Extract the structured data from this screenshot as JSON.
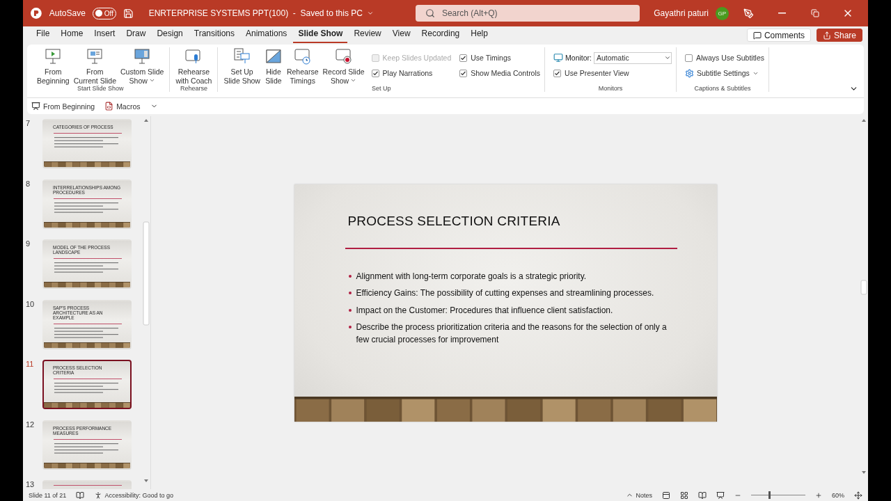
{
  "title_bar": {
    "autosave_label": "AutoSave",
    "autosave": {
      "on": false,
      "label": "Off"
    },
    "document": "ENRTERPRISE SYSTEMS PPT(100)  -  Saved to this PC",
    "search_placeholder": "Search (Alt+Q)",
    "user": "Gayathri paturi",
    "avatar": "GP"
  },
  "menu_tabs": [
    {
      "label": "File",
      "selected": false
    },
    {
      "label": "Home",
      "selected": false
    },
    {
      "label": "Insert",
      "selected": false
    },
    {
      "label": "Draw",
      "selected": false
    },
    {
      "label": "Design",
      "selected": false
    },
    {
      "label": "Transitions",
      "selected": false
    },
    {
      "label": "Animations",
      "selected": false
    },
    {
      "label": "Slide Show",
      "selected": true
    },
    {
      "label": "Review",
      "selected": false
    },
    {
      "label": "View",
      "selected": false
    },
    {
      "label": "Recording",
      "selected": false
    },
    {
      "label": "Help",
      "selected": false
    }
  ],
  "actions": {
    "comments": "Comments",
    "share": "Share"
  },
  "ribbon_groups": [
    {
      "title": "Start Slide Show",
      "items": [
        {
          "kind": "big",
          "lines": [
            "From",
            "Beginning"
          ],
          "dropdown": false
        },
        {
          "kind": "big",
          "lines": [
            "From",
            "Current Slide"
          ],
          "dropdown": false
        },
        {
          "kind": "big",
          "lines": [
            "Custom Slide",
            "Show"
          ],
          "dropdown": true
        }
      ]
    },
    {
      "title": "Rehearse",
      "items": [
        {
          "kind": "big",
          "lines": [
            "Rehearse",
            "with Coach"
          ],
          "dropdown": false
        }
      ]
    },
    {
      "title": "Set Up",
      "items": [
        {
          "kind": "big",
          "lines": [
            "Set Up",
            "Slide Show"
          ],
          "dropdown": false
        },
        {
          "kind": "big",
          "lines": [
            "Hide",
            "Slide"
          ],
          "dropdown": false
        },
        {
          "kind": "big",
          "lines": [
            "Rehearse",
            "Timings"
          ],
          "dropdown": false
        },
        {
          "kind": "big",
          "lines": [
            "Record Slide",
            "Show"
          ],
          "dropdown": true
        },
        {
          "kind": "checkbox",
          "label": "Keep Slides Updated",
          "checked": false,
          "disabled": true
        },
        {
          "kind": "checkbox",
          "label": "Play Narrations",
          "checked": true,
          "disabled": false
        },
        {
          "kind": "checkbox",
          "label": "Use Timings",
          "checked": true,
          "disabled": false
        },
        {
          "kind": "checkbox",
          "label": "Show Media Controls",
          "checked": true,
          "disabled": false
        }
      ]
    },
    {
      "title": "Monitors",
      "items": [
        {
          "kind": "select",
          "label": "Monitor:",
          "value": "Automatic"
        },
        {
          "kind": "checkbox",
          "label": "Use Presenter View",
          "checked": true,
          "disabled": false
        }
      ]
    },
    {
      "title": "Captions & Subtitles",
      "items": [
        {
          "kind": "checkbox",
          "label": "Always Use Subtitles",
          "checked": false,
          "disabled": false
        },
        {
          "kind": "menu",
          "label": "Subtitle Settings"
        }
      ]
    }
  ],
  "quick_access": [
    {
      "label": "From Beginning"
    },
    {
      "label": "Macros"
    }
  ],
  "slides": [
    {
      "number": "7",
      "title": "CATEGORIES OF PROCESS",
      "selected": false
    },
    {
      "number": "8",
      "title": "INTERRELATIONSHIPS AMONG PROCEDURES",
      "selected": false
    },
    {
      "number": "9",
      "title": "MODEL OF THE PROCESS LANDSCAPE",
      "selected": false
    },
    {
      "number": "10",
      "title": "SAP'S PROCESS ARCHITECTURE AS AN EXAMPLE",
      "selected": false
    },
    {
      "number": "11",
      "title": "PROCESS SELECTION CRITERIA",
      "selected": true
    },
    {
      "number": "12",
      "title": "PROCESS PERFORMANCE MEASURES",
      "selected": false
    },
    {
      "number": "13",
      "selected": false
    }
  ],
  "current_slide": {
    "title": "PROCESS SELECTION CRITERIA",
    "bullets": [
      "Alignment with long-term corporate goals is a strategic priority.",
      "Efficiency Gains: The possibility of cutting expenses and streamlining processes.",
      "Impact on the Customer: Procedures that influence client satisfaction.",
      "Describe the process prioritization criteria and the reasons for the selection of only a few crucial processes for improvement"
    ]
  },
  "status_bar": {
    "slide_info": "Slide 11 of 21",
    "accessibility": "Accessibility: Good to go",
    "notes": "Notes",
    "zoom": {
      "level": 0.33,
      "reading": "60%"
    }
  }
}
